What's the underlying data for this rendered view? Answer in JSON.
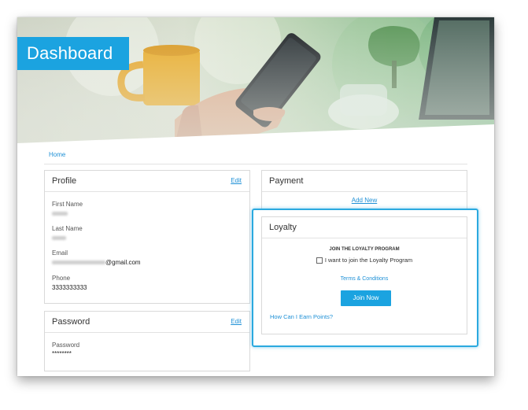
{
  "header": {
    "title": "Dashboard"
  },
  "breadcrumb": {
    "home": "Home"
  },
  "profile": {
    "title": "Profile",
    "edit_label": "Edit",
    "first_name_label": "First Name",
    "last_name_label": "Last Name",
    "email_label": "Email",
    "email_domain": "@gmail.com",
    "phone_label": "Phone",
    "phone_value": "3333333333"
  },
  "password": {
    "title": "Password",
    "edit_label": "Edit",
    "field_label": "Password",
    "field_value": "********"
  },
  "payment": {
    "title": "Payment",
    "add_new": "Add New"
  },
  "loyalty": {
    "title": "Loyalty",
    "heading": "JOIN THE LOYALTY PROGRAM",
    "checkbox_label": "I want to join the Loyalty Program",
    "terms": "Terms & Conditions",
    "join_button": "Join Now",
    "earn_points": "How Can I Earn Points?"
  },
  "colors": {
    "accent": "#1ba3e0",
    "link": "#1e90d6"
  }
}
